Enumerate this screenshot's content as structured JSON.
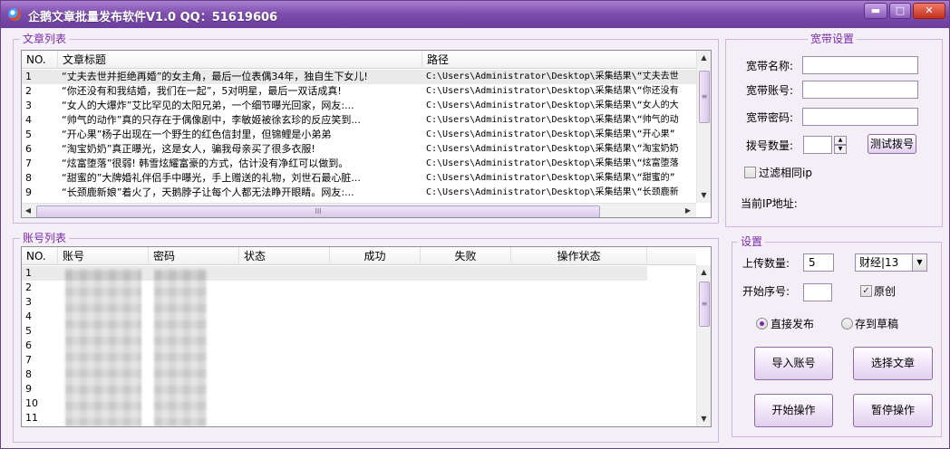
{
  "window": {
    "title": "企鹅文章批量发布软件V1.0 QQ：51619606",
    "buttons": {
      "minimize": "▬",
      "maximize": "□",
      "close": "✕"
    }
  },
  "articles": {
    "group_title": "文章列表",
    "columns": [
      "NO.",
      "文章标题",
      "路径"
    ],
    "rows": [
      {
        "no": "1",
        "title": "“丈夫去世并拒绝再婚”的女主角，最后一位表偶34年，独自生下女儿!",
        "path": "C:\\Users\\Administrator\\Desktop\\采集结果\\“丈夫去世"
      },
      {
        "no": "2",
        "title": "“你还没有和我结婚，我们在一起”，5对明星，最后一双话成真!",
        "path": "C:\\Users\\Administrator\\Desktop\\采集结果\\“你还没有"
      },
      {
        "no": "3",
        "title": "“女人的大爆炸”艾比罕见的太阳兄弟，一个细节曝光回家，网友:...",
        "path": "C:\\Users\\Administrator\\Desktop\\采集结果\\“女人的大"
      },
      {
        "no": "4",
        "title": "“帅气的动作”真的只存在于偶像剧中，李敏姬被徐玄珍的反应笑到...",
        "path": "C:\\Users\\Administrator\\Desktop\\采集结果\\“帅气的动"
      },
      {
        "no": "5",
        "title": "“开心果”杨子出现在一个野生的红色信封里，但锦鲤是小弟弟",
        "path": "C:\\Users\\Administrator\\Desktop\\采集结果\\“开心果”"
      },
      {
        "no": "6",
        "title": "“淘宝奶奶”真正曝光，这是女人，骗我母亲买了很多衣服!",
        "path": "C:\\Users\\Administrator\\Desktop\\采集结果\\“淘宝奶奶"
      },
      {
        "no": "7",
        "title": "“炫富堕落”很弱! 韩雪炫耀富豪的方式，估计没有净红可以做到。",
        "path": "C:\\Users\\Administrator\\Desktop\\采集结果\\“炫富堕落"
      },
      {
        "no": "8",
        "title": "“甜蜜的”大牌婚礼伴侣手中曝光，手上赠送的礼物，刘世石最心脏...",
        "path": "C:\\Users\\Administrator\\Desktop\\采集结果\\“甜蜜的”"
      },
      {
        "no": "9",
        "title": "“长颈鹿新娘”着火了，天鹅脖子让每个人都无法睁开眼睛。网友:...",
        "path": "C:\\Users\\Administrator\\Desktop\\采集结果\\“长颈鹿新"
      }
    ],
    "hscroll_grip": "III"
  },
  "accounts": {
    "group_title": "账号列表",
    "columns": [
      "NO.",
      "账号",
      "密码",
      "状态",
      "成功",
      "失败",
      "操作状态"
    ],
    "rows": [
      "1",
      "2",
      "3",
      "4",
      "5",
      "6",
      "7",
      "8",
      "9",
      "10",
      "11"
    ]
  },
  "broadband": {
    "group_title": "宽带设置",
    "name_label": "宽带名称:",
    "account_label": "宽带账号:",
    "password_label": "宽带密码:",
    "dial_count_label": "拨号数量:",
    "test_dial_button": "测试拨号",
    "filter_ip_label": "过滤相同ip",
    "current_ip_label": "当前IP地址:"
  },
  "settings": {
    "group_title": "设置",
    "upload_count_label": "上传数量:",
    "upload_count_value": "5",
    "category_value": "财经|13",
    "start_index_label": "开始序号:",
    "original_label": "原创",
    "direct_publish_label": "直接发布",
    "save_draft_label": "存到草稿",
    "import_accounts_button": "导入账号",
    "select_articles_button": "选择文章",
    "start_button": "开始操作",
    "pause_button": "暂停操作"
  },
  "colors": {
    "accent": "#7a2ca8",
    "titlebar": "#7e4faf"
  }
}
